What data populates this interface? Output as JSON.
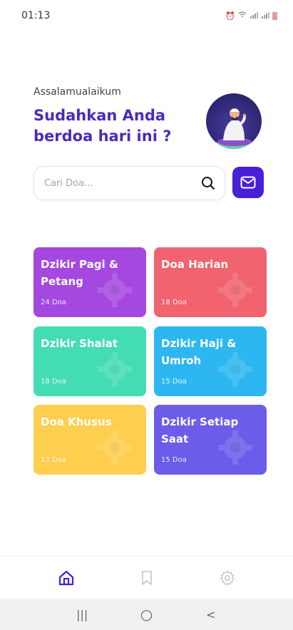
{
  "status_bar": {
    "time": "01:13",
    "icons": [
      "alarm-icon",
      "wifi-icon",
      "signal-icon",
      "signal-icon",
      "battery-icon"
    ]
  },
  "header": {
    "greeting": "Assalamualaikum",
    "headline": "Sudahkan Anda berdoa hari ini ?"
  },
  "search": {
    "placeholder": "Cari Doa...",
    "value": ""
  },
  "categories": [
    {
      "title": "Dzikir Pagi & Petang",
      "count": "24 Doa",
      "color": "#a448e0"
    },
    {
      "title": "Doa Harian",
      "count": "18 Doa",
      "color": "#f0636f"
    },
    {
      "title": "Dzikir Shalat",
      "count": "18 Doa",
      "color": "#44dcb3"
    },
    {
      "title": "Dzikir Haji & Umroh",
      "count": "15 Doa",
      "color": "#2db7f1"
    },
    {
      "title": "Doa Khusus",
      "count": "13 Doa",
      "color": "#fece4f"
    },
    {
      "title": "Dzikir Setiap Saat",
      "count": "15 Doa",
      "color": "#6b5cea"
    }
  ],
  "bottom_nav": {
    "items": [
      "home-icon",
      "bookmark-icon",
      "settings-icon"
    ],
    "active": "home-icon",
    "active_color": "#4a1fd8"
  },
  "system_nav": {
    "recents": "|||",
    "home": "○",
    "back": "<"
  },
  "colors": {
    "accent": "#4a1fd8",
    "headline": "#4a2bbd"
  }
}
